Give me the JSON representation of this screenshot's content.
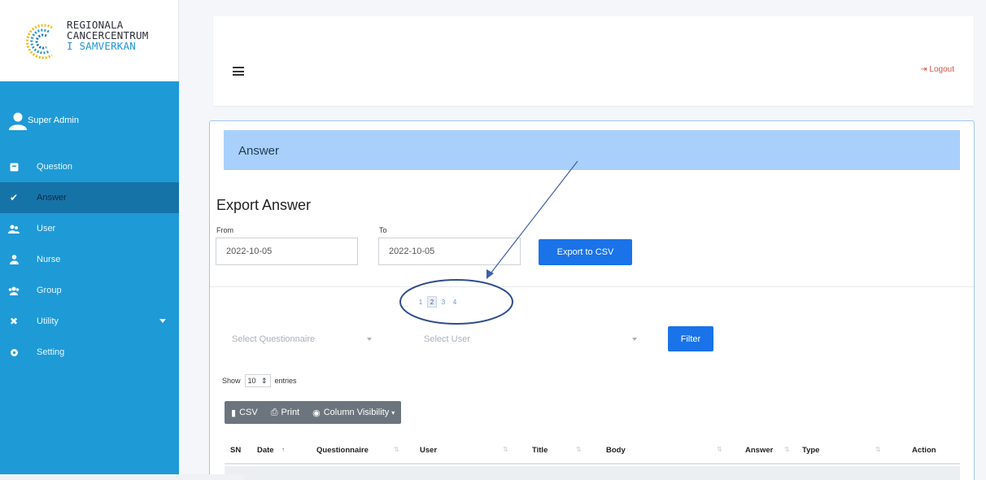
{
  "brand": {
    "line1": "REGIONALA",
    "line2": "CANCERCENTRUM",
    "line3": "I SAMVERKAN"
  },
  "colors": {
    "sidebar": "#1e9ad6",
    "sidebar_active": "#1673a8",
    "panel_header": "#a8d0fb",
    "primary_button": "#1a73e8",
    "logout": "#d9534f"
  },
  "sidebar": {
    "user": "Super Admin",
    "items": [
      {
        "label": "Question",
        "icon": "question-icon",
        "active": false
      },
      {
        "label": "Answer",
        "icon": "check-icon",
        "active": true
      },
      {
        "label": "User",
        "icon": "users-icon",
        "active": false
      },
      {
        "label": "Nurse",
        "icon": "user-icon",
        "active": false
      },
      {
        "label": "Group",
        "icon": "group-icon",
        "active": false
      },
      {
        "label": "Utility",
        "icon": "tools-icon",
        "active": false
      },
      {
        "label": "Setting",
        "icon": "gear-icon",
        "active": false
      }
    ]
  },
  "topbar": {
    "logout_label": "Logout"
  },
  "panel": {
    "header": "Answer",
    "export": {
      "title": "Export Answer",
      "from_label": "From",
      "from_value": "2022-10-05",
      "to_label": "To",
      "to_value": "2022-10-05",
      "button": "Export to CSV"
    },
    "pagination": [
      "1",
      "2",
      "3",
      "4"
    ],
    "current_page": "2",
    "filters": {
      "questionnaire_placeholder": "Select Questionnaire",
      "user_placeholder": "Select User",
      "button": "Filter"
    },
    "length": {
      "show": "Show",
      "value": "10",
      "entries": "entries"
    },
    "buttons": {
      "csv": "CSV",
      "print": "Print",
      "column_visibility": "Column Visibility"
    },
    "table": {
      "columns": [
        "SN",
        "Date",
        "Questionnaire",
        "User",
        "Title",
        "Body",
        "Answer",
        "Type",
        "Action"
      ]
    }
  }
}
